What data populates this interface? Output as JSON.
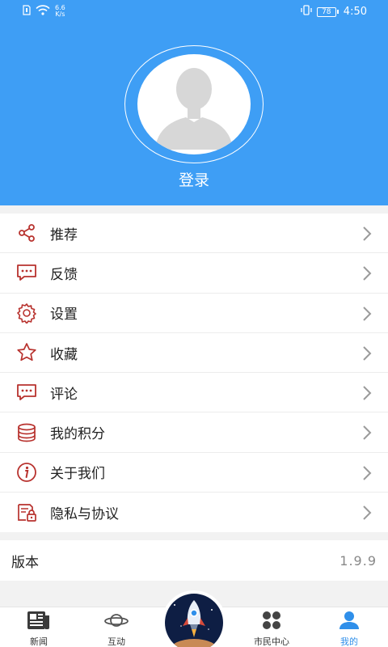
{
  "status_bar": {
    "speed_value": "6.6",
    "speed_unit": "K/s",
    "battery": "78",
    "time": "4:50"
  },
  "header": {
    "login_label": "登录",
    "background_color": "#3e9ef5"
  },
  "menu": {
    "items": [
      {
        "label": "推荐",
        "icon": "share-icon"
      },
      {
        "label": "反馈",
        "icon": "chat-dots-icon"
      },
      {
        "label": "设置",
        "icon": "gear-icon"
      },
      {
        "label": "收藏",
        "icon": "star-icon"
      },
      {
        "label": "评论",
        "icon": "comment-icon"
      },
      {
        "label": "我的积分",
        "icon": "coins-stack-icon"
      },
      {
        "label": "关于我们",
        "icon": "info-icon"
      },
      {
        "label": "隐私与协议",
        "icon": "lock-document-icon"
      }
    ],
    "icon_color": "#b8322e"
  },
  "version": {
    "label": "版本",
    "value": "1.9.9"
  },
  "tabbar": {
    "tabs": [
      {
        "label": "新闻",
        "icon": "newspaper-icon"
      },
      {
        "label": "互动",
        "icon": "planet-icon"
      },
      {
        "label": "市民中心",
        "icon": "four-petal-icon"
      },
      {
        "label": "我的",
        "icon": "user-icon"
      }
    ],
    "active": "我的",
    "center_icon": "rocket-icon",
    "active_color": "#2f8fea"
  }
}
